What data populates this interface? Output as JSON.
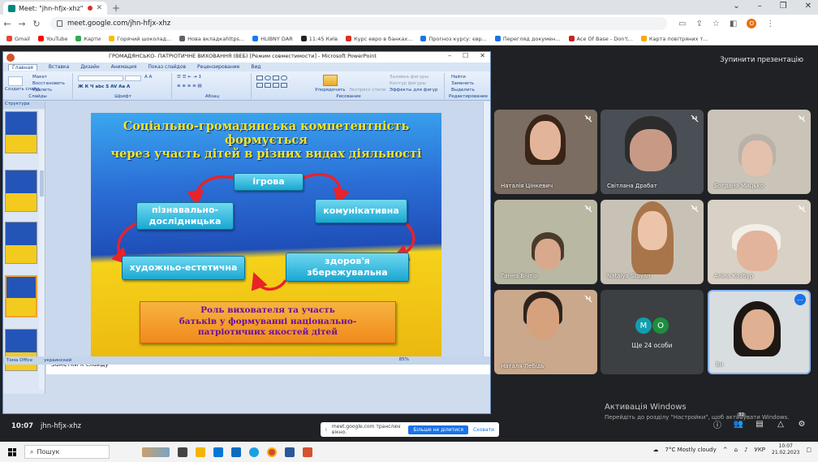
{
  "browser": {
    "tab_title": "Meet: \"jhn-hfjx-xhz\"",
    "url": "meet.google.com/jhn-hfjx-xhz",
    "profile_initial": "O",
    "bookmarks": [
      {
        "label": "Gmail",
        "color": "#ea4335"
      },
      {
        "label": "YouTube",
        "color": "#ff0000"
      },
      {
        "label": "Карти",
        "color": "#34a853"
      },
      {
        "label": "Горячий шоколад...",
        "color": "#fbbc04"
      },
      {
        "label": "Нова вкладкаhttps...",
        "color": "#5f6368"
      },
      {
        "label": "HLIBNY DAR",
        "color": "#1877f2"
      },
      {
        "label": "11:45 Київ",
        "color": "#202124"
      },
      {
        "label": "Курс евро в банках...",
        "color": "#d93025"
      },
      {
        "label": "Прогноз курсу: євр...",
        "color": "#1a73e8"
      },
      {
        "label": "Перегляд докумен...",
        "color": "#1a73e8"
      },
      {
        "label": "Ace Of Base - Don't...",
        "color": "#c5221f"
      },
      {
        "label": "Карта повітряних т...",
        "color": "#f9ab00"
      }
    ]
  },
  "meet": {
    "stop_presenting": "Зупинити презентацію",
    "time": "10:07",
    "code": "jhn-hfjx-xhz",
    "participants": [
      {
        "name": "Наталія Цінкевич"
      },
      {
        "name": "Світлана Драбат"
      },
      {
        "name": "Богдана Мицько"
      },
      {
        "name": "Ганна Вічтір"
      },
      {
        "name": "Natalya Stoyan"
      },
      {
        "name": "Аліна Козбур"
      },
      {
        "name": "Наталя Лебідь"
      },
      {
        "name": "Ви"
      }
    ],
    "others": {
      "initials": [
        "M",
        "O"
      ],
      "label": "Ще 24 особи"
    },
    "share_banner": {
      "text": "meet.google.com транслює вікно.",
      "stop": "Більше не ділитися",
      "hide": "Сховати"
    },
    "people_count": "32"
  },
  "ppt": {
    "window_title": "ГРОМАДЯНСЬКО- ПАТРІОТИЧНЕ ВИХОВАННЯ (ВЕБ) [Режим совместимости] - Microsoft PowerPoint",
    "ribbon_tabs": [
      "Главная",
      "Вставка",
      "Дизайн",
      "Анимация",
      "Показ слайдов",
      "Рецензирование",
      "Вид"
    ],
    "groups": [
      "Слайды",
      "Шрифт",
      "Абзац",
      "Рисование",
      "Редактирование"
    ],
    "buttons": {
      "create_slide": "Создать слайд",
      "layout": "Макет",
      "restore": "Восстановить",
      "delete": "Удалить",
      "arrange": "Упорядочить",
      "express_styles": "Экспресс-стили",
      "fill": "Заливка фигуры",
      "outline": "Контур фигуры",
      "effects": "Эффекты для фигур",
      "find": "Найти",
      "replace": "Заменить",
      "select": "Выделить"
    },
    "thumb_header": "Структура",
    "notes_placeholder": "Заметки к слайду",
    "status_theme": "Тема Office",
    "status_lang": "украинский",
    "zoom": "85%",
    "slide": {
      "title_lines": [
        "Соціально-громадянська компетентність",
        "формується",
        "через участь дітей в різних видах діяльності"
      ],
      "nodes": {
        "play": "ігрова",
        "cognitive": "пізнавально-дослідницька",
        "communicative": "комунікативна",
        "artistic": "художньо-естетична",
        "health": "здоров'я збережувальна"
      },
      "role_lines": [
        "Роль вихователя та участь",
        "батьків у формуванні національно-",
        "патріотичних якостей  дітей"
      ]
    }
  },
  "windows": {
    "activate_title": "Активація Windows",
    "activate_sub": "Перейдіть до розділу \"Настройки\", щоб активувати Windows.",
    "search": "Пошук",
    "weather": "7°C  Mostly cloudy",
    "lang": "УКР",
    "clock_time": "10:07",
    "clock_date": "21.02.2023"
  }
}
